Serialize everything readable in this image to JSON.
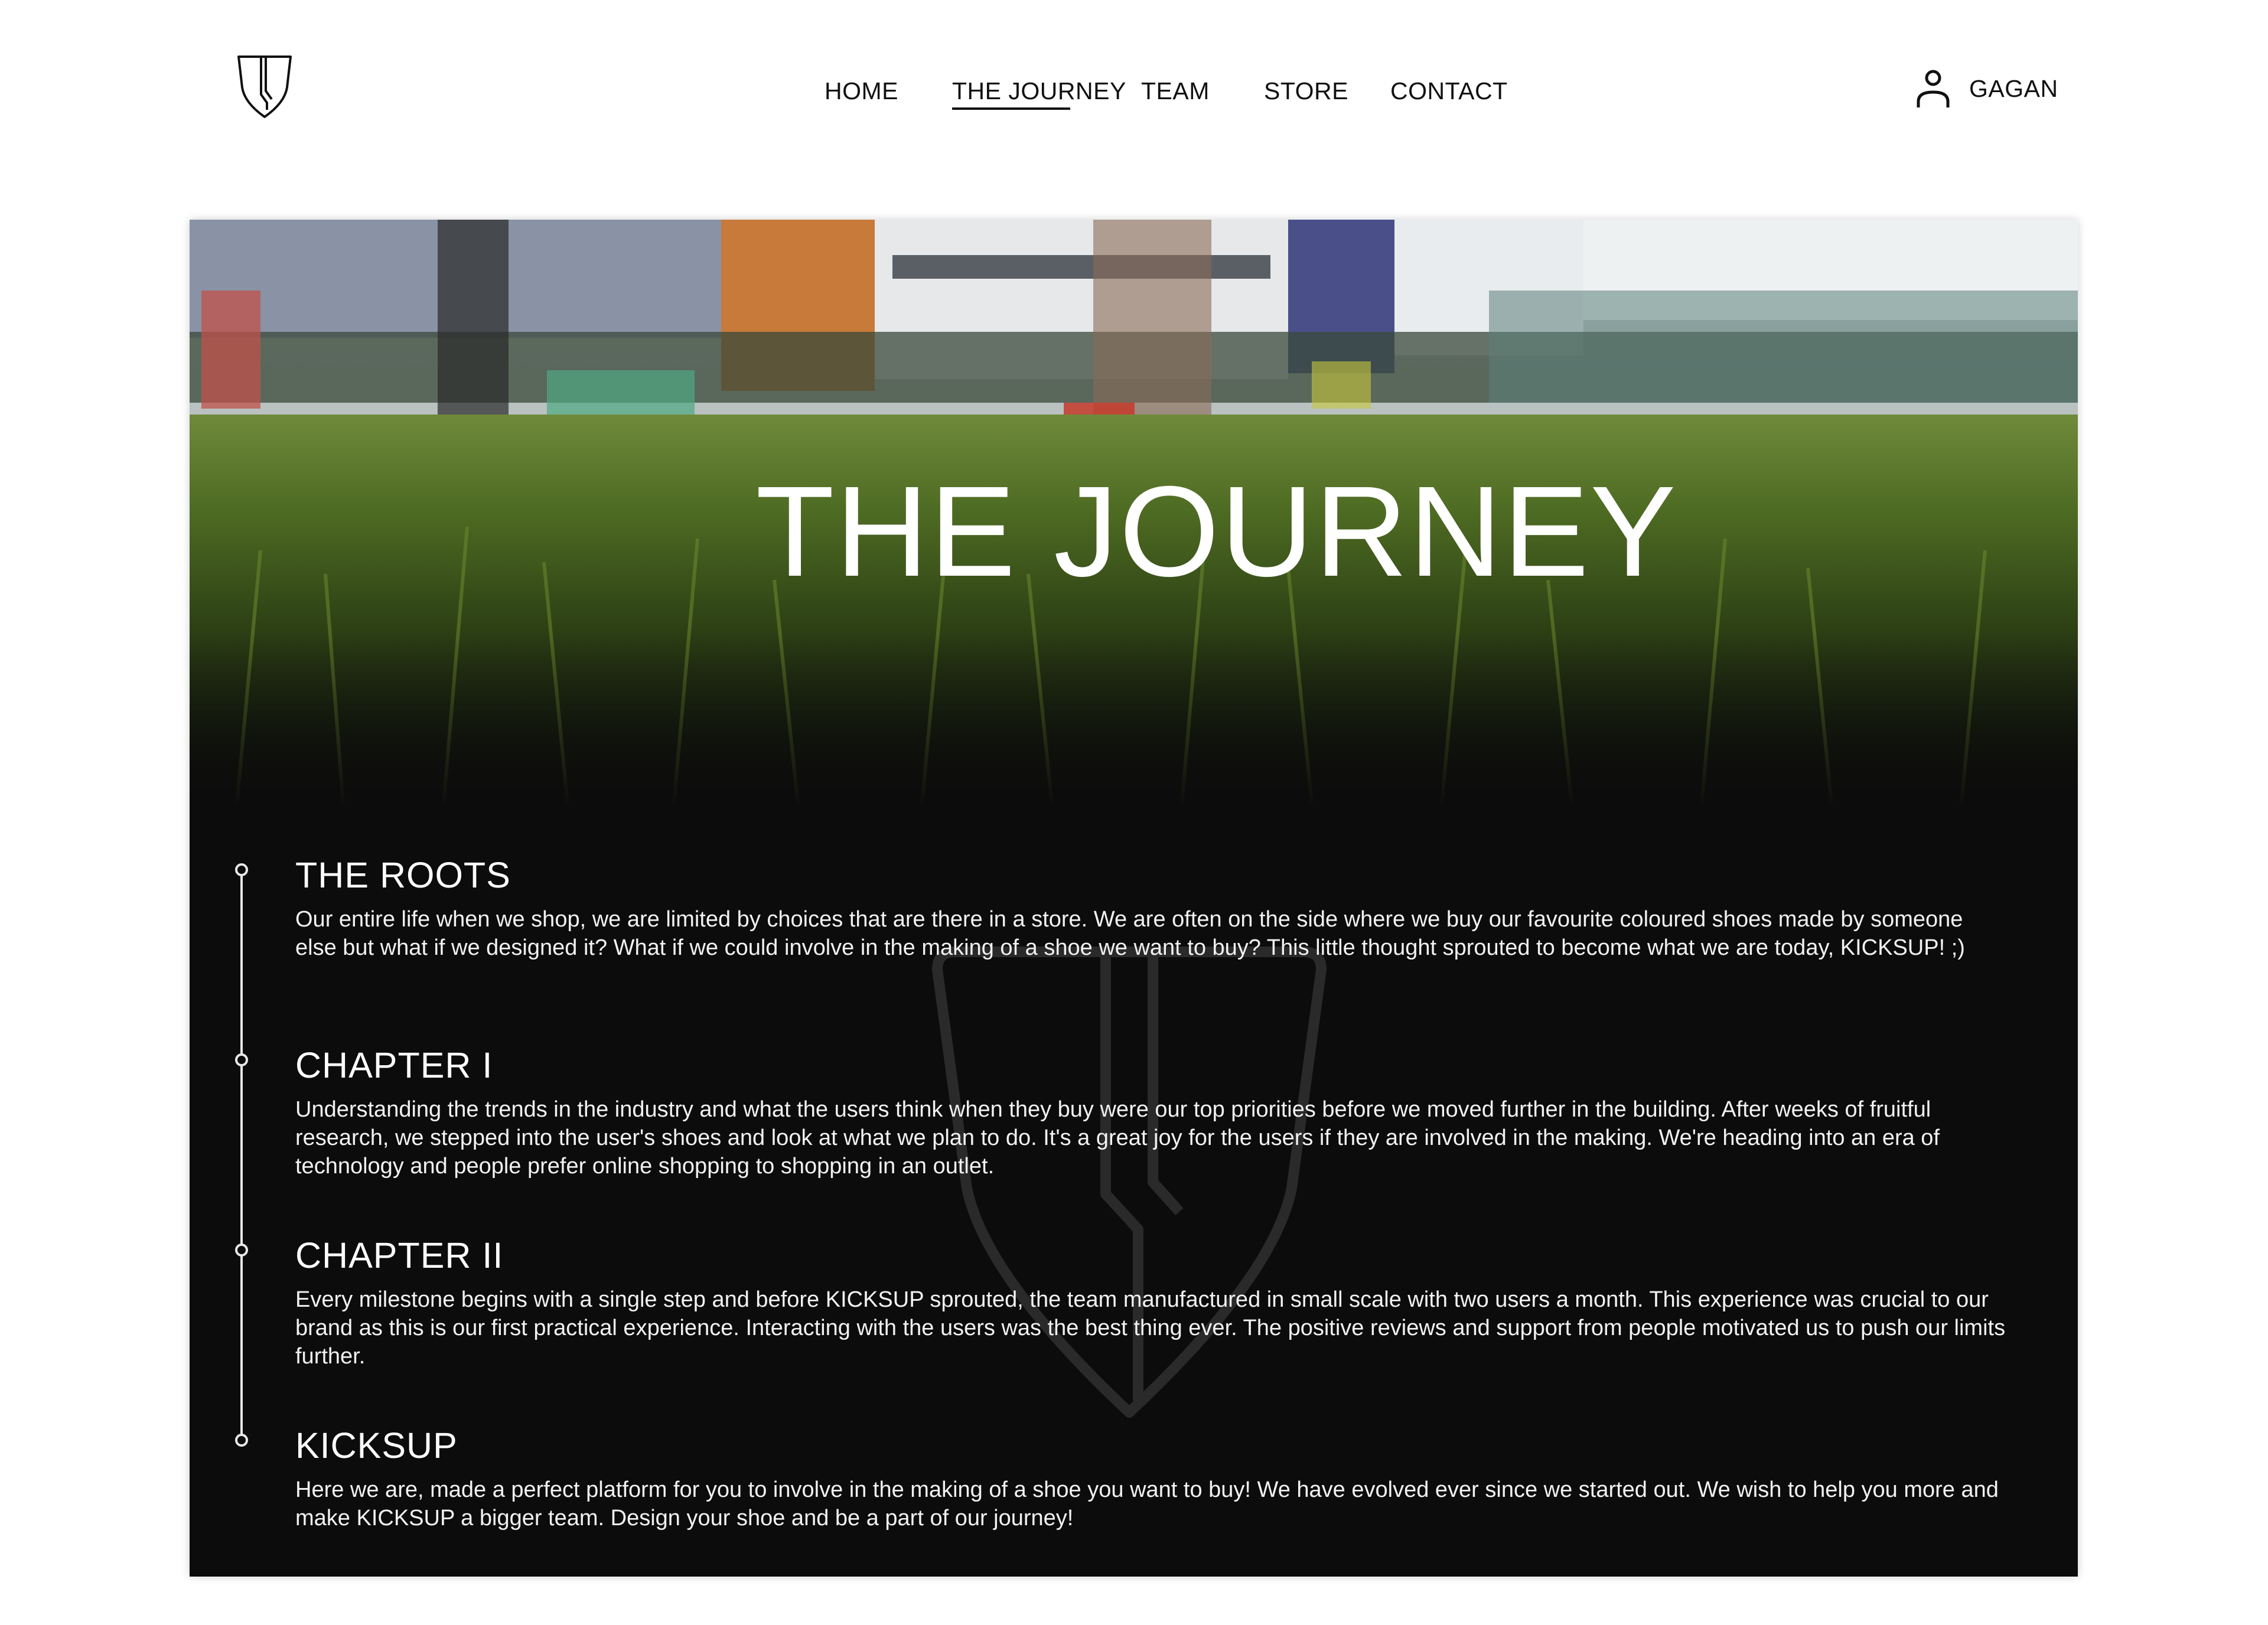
{
  "header": {
    "logo": "kicksup-shield-logo",
    "nav": [
      {
        "label": "HOME",
        "active": false
      },
      {
        "label": "THE JOURNEY",
        "active": true
      },
      {
        "label": "TEAM",
        "active": false
      },
      {
        "label": "STORE",
        "active": false
      },
      {
        "label": "CONTACT",
        "active": false
      }
    ],
    "user": {
      "icon": "user-icon",
      "name": "GAGAN"
    }
  },
  "hero": {
    "title": "THE JOURNEY",
    "image": "grass-field-photo"
  },
  "timeline": [
    {
      "heading": "THE ROOTS",
      "text": "Our entire life when we shop, we are limited by choices that are there in a store. We are often on the side where we buy our favourite coloured shoes made by someone else but what if we designed it? What if we could involve in the making of a shoe we want to  buy? This little thought sprouted to become what we are today, KICKSUP! ;)"
    },
    {
      "heading": "CHAPTER I",
      "text": "Understanding the trends in the industry and what the users think when they buy were our top priorities before we moved further in the building. After weeks of fruitful research, we stepped into the user's shoes and look at what we plan to do. It's a great joy for the users if they are involved in the making. We're heading into an era of technology and people prefer online shopping to shopping in an outlet."
    },
    {
      "heading": "CHAPTER II",
      "text": "Every milestone begins with a single step and before KICKSUP sprouted, the team manufactured in small scale with two users a month. This experience was crucial to our brand as this is our first practical experience. Interacting with the users was the best thing ever. The positive reviews and support from people motivated us to push our limits further."
    },
    {
      "heading": "KICKSUP",
      "text": "Here we are, made a perfect platform for you to involve in the making of a shoe you want to buy! We have evolved ever since we started out. We wish to help you more and make KICKSUP a bigger team. Design your shoe and be a part of our journey!"
    }
  ],
  "colors": {
    "background": "#ffffff",
    "card": "#0c0c0c",
    "text_dark": "#111111",
    "text_light": "#ffffff",
    "grass": "#3d5a1a"
  }
}
